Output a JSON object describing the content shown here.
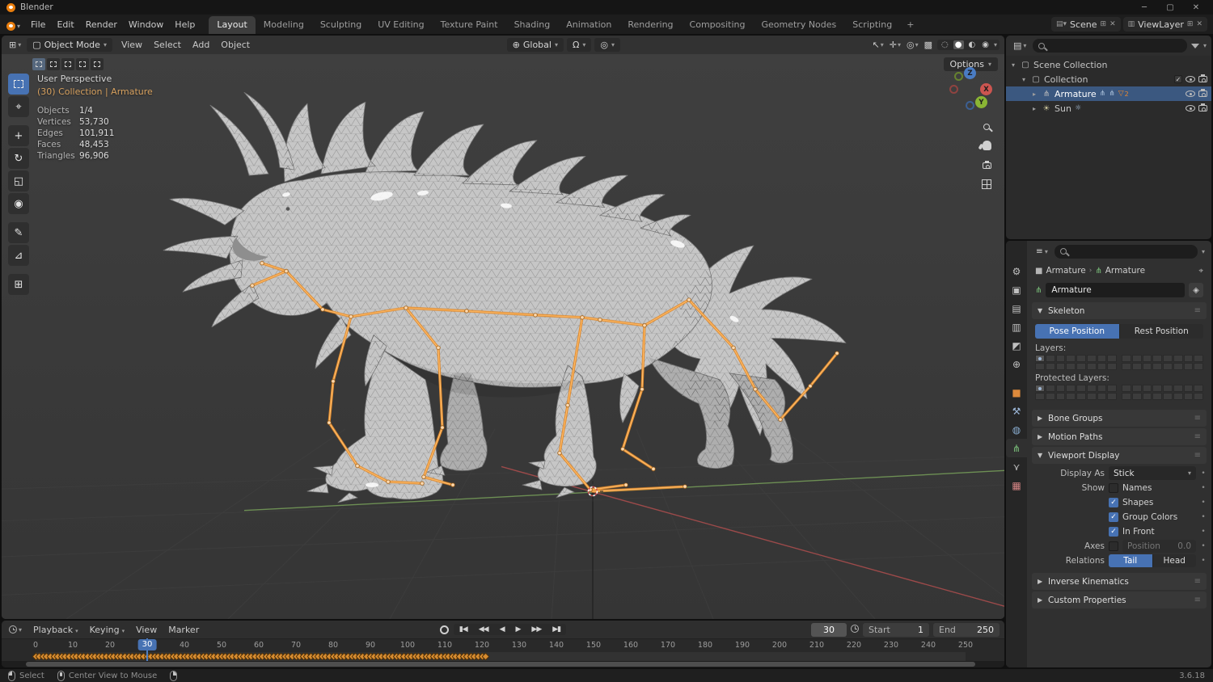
{
  "window": {
    "title": "Blender"
  },
  "topbar": {
    "menus": [
      "File",
      "Edit",
      "Render",
      "Window",
      "Help"
    ],
    "tabs": [
      "Layout",
      "Modeling",
      "Sculpting",
      "UV Editing",
      "Texture Paint",
      "Shading",
      "Animation",
      "Rendering",
      "Compositing",
      "Geometry Nodes",
      "Scripting"
    ],
    "active_tab": "Layout",
    "new_tab_label": "+",
    "scene_label": "Scene",
    "view_layer_label": "ViewLayer"
  },
  "viewport": {
    "header": {
      "mode": "Object Mode",
      "menus": [
        "View",
        "Select",
        "Add",
        "Object"
      ],
      "orientation": "Global",
      "options_label": "Options",
      "select_modes": [
        "new",
        "extend",
        "subtract",
        "invert",
        "intersect"
      ]
    },
    "tools": [
      "select-box",
      "cursor",
      "move",
      "rotate",
      "scale",
      "transform",
      "annotate",
      "measure",
      "add-cube"
    ],
    "overlay": {
      "view_label": "User Perspective",
      "context_label": "(30) Collection | Armature",
      "stats": [
        {
          "label": "Objects",
          "value": "1/4"
        },
        {
          "label": "Vertices",
          "value": "53,730"
        },
        {
          "label": "Edges",
          "value": "101,911"
        },
        {
          "label": "Faces",
          "value": "48,453"
        },
        {
          "label": "Triangles",
          "value": "96,906"
        }
      ]
    },
    "gizmo_axes": [
      "X",
      "Y",
      "Z"
    ]
  },
  "outliner": {
    "rows": [
      {
        "label": "Scene Collection",
        "icon": "collection",
        "disclosure": "down",
        "level": 0,
        "right": []
      },
      {
        "label": "Collection",
        "icon": "collection",
        "disclosure": "down",
        "level": 1,
        "right": [
          "checkbox",
          "eye",
          "camera"
        ]
      },
      {
        "label": "Armature",
        "icon": "armature",
        "disclosure": "right",
        "level": 2,
        "selected": true,
        "extras": [
          "pose",
          "armature-data"
        ],
        "badge": "2",
        "right": [
          "eye",
          "camera"
        ]
      },
      {
        "label": "Sun",
        "icon": "light",
        "disclosure": "right",
        "level": 2,
        "extras": [
          "sun-data"
        ],
        "right": [
          "eye",
          "camera"
        ]
      }
    ]
  },
  "properties": {
    "tabs": [
      "tool",
      "render",
      "output",
      "view-layer",
      "scene",
      "world",
      "object",
      "constraints",
      "physics",
      "object-data",
      "bone",
      "texture"
    ],
    "active_tab": "object-data",
    "breadcrumb": [
      "Armature",
      "Armature"
    ],
    "name_value": "Armature",
    "skeleton": {
      "title": "Skeleton",
      "pose_button": "Pose Position",
      "rest_button": "Rest Position",
      "layers_label": "Layers:",
      "protected_label": "Protected Layers:"
    },
    "collapsed_panels_mid": [
      "Bone Groups",
      "Motion Paths"
    ],
    "viewport_display": {
      "title": "Viewport Display",
      "display_as_label": "Display As",
      "display_as_value": "Stick",
      "show_label": "Show",
      "show_items": [
        {
          "label": "Names",
          "checked": false
        },
        {
          "label": "Shapes",
          "checked": true
        },
        {
          "label": "Group Colors",
          "checked": true
        },
        {
          "label": "In Front",
          "checked": true
        }
      ],
      "axes_label": "Axes",
      "axes_checked": false,
      "position_label": "Position",
      "position_value": "0.0",
      "relations_label": "Relations",
      "relations": [
        "Tail",
        "Head"
      ],
      "relations_active": "Tail"
    },
    "collapsed_panels_bottom": [
      "Inverse Kinematics",
      "Custom Properties"
    ]
  },
  "timeline": {
    "menus": [
      "Playback",
      "Keying",
      "View",
      "Marker"
    ],
    "playback_buttons": [
      "jump-to-start",
      "jump-to-prev-keyframe",
      "play-reverse",
      "play",
      "jump-to-next-keyframe",
      "jump-to-end"
    ],
    "current_frame": "30",
    "start_label": "Start",
    "start_value": "1",
    "end_label": "End",
    "end_value": "250",
    "ruler": {
      "min": 0,
      "max": 250,
      "step": 10
    },
    "keyframes": {
      "first": 0,
      "last": 121
    }
  },
  "statusbar": {
    "hints": [
      {
        "button": "left",
        "label": "Select"
      },
      {
        "button": "middle",
        "label": "Center View to Mouse"
      },
      {
        "button": "right",
        "label": ""
      }
    ],
    "version": "3.6.18"
  },
  "colors": {
    "accent": "#4772b3",
    "selection": "#3b5880",
    "bone_orange": "#f29a3d",
    "keyframe_orange": "#d68c31",
    "context_text": "#d7a15f"
  }
}
